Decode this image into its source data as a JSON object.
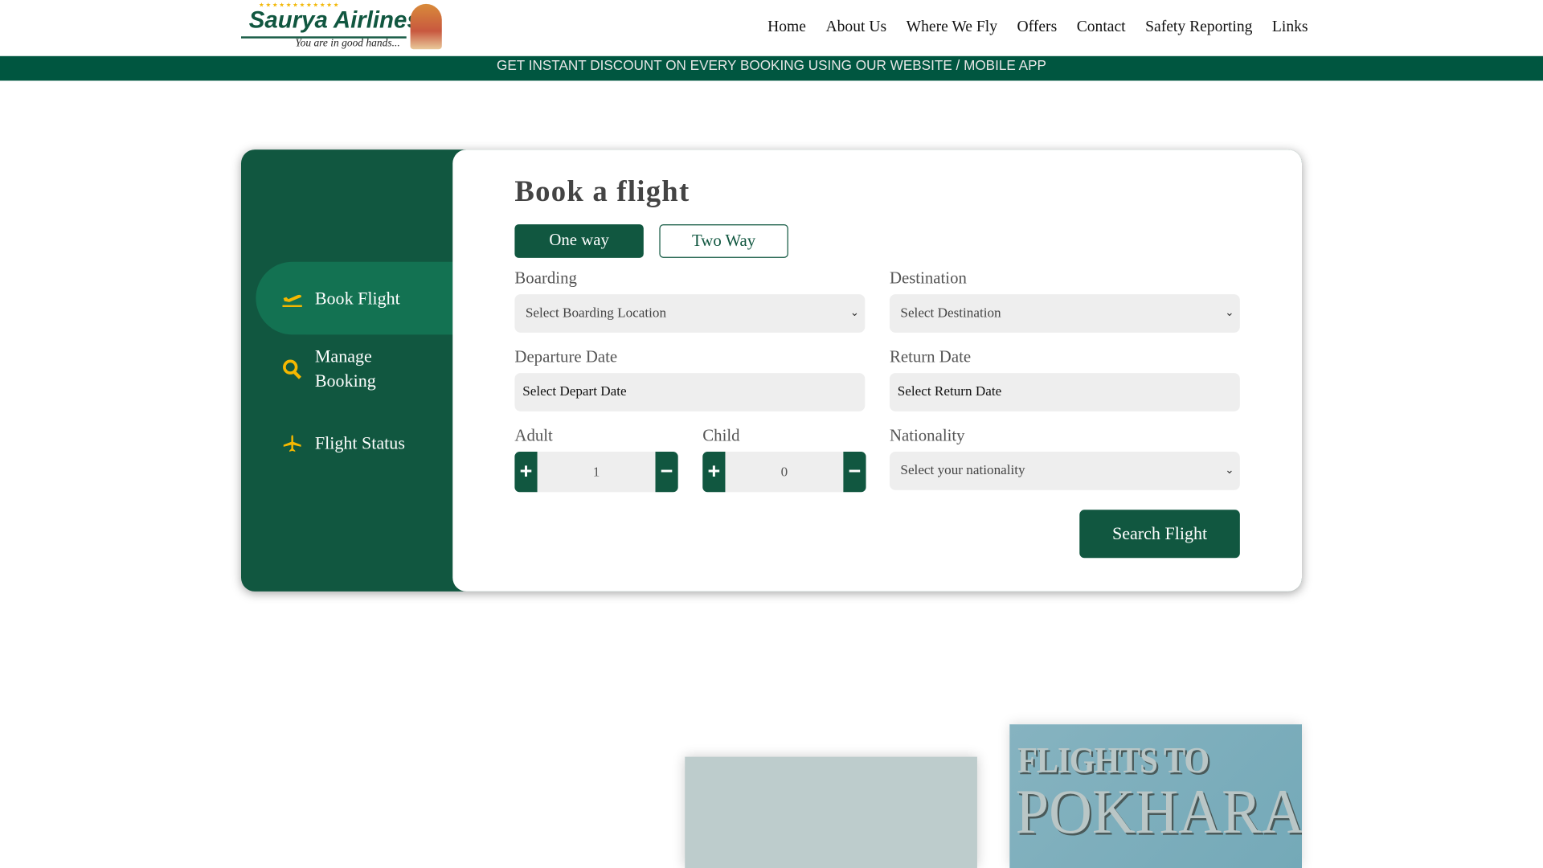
{
  "header": {
    "logo_text": "Saurya Airlines",
    "logo_tagline": "You are in good hands...",
    "logo_stars": "★★★★★★★★★★★★",
    "nav": [
      "Home",
      "About Us",
      "Where We Fly",
      "Offers",
      "Contact",
      "Safety Reporting",
      "Links"
    ]
  },
  "banner": "GET INSTANT DISCOUNT ON EVERY BOOKING USING OUR WEBSITE / MOBILE APP",
  "sidebar": {
    "items": [
      {
        "label": "Book Flight",
        "icon": "plane-departure-icon"
      },
      {
        "label": "Manage Booking",
        "icon": "search-icon"
      },
      {
        "label": "Flight Status",
        "icon": "plane-icon"
      }
    ]
  },
  "form": {
    "title": "Book a flight",
    "trip_types": [
      "One way",
      "Two Way"
    ],
    "selected_trip": "One way",
    "boarding_label": "Boarding",
    "boarding_value": "Select Boarding Location",
    "destination_label": "Destination",
    "destination_value": "Select Destination",
    "departure_label": "Departure Date",
    "departure_placeholder": "Select Depart Date",
    "return_label": "Return Date",
    "return_placeholder": "Select Return Date",
    "adult_label": "Adult",
    "adult_value": "1",
    "child_label": "Child",
    "child_value": "0",
    "nationality_label": "Nationality",
    "nationality_value": "Select your nationality",
    "search_label": "Search Flight"
  },
  "promos": {
    "pokhara_line1": "FLIGHTS TO",
    "pokhara_line2": "POKHARA"
  },
  "colors": {
    "brand": "#115740",
    "active": "#137252",
    "accent": "#f5b800"
  }
}
